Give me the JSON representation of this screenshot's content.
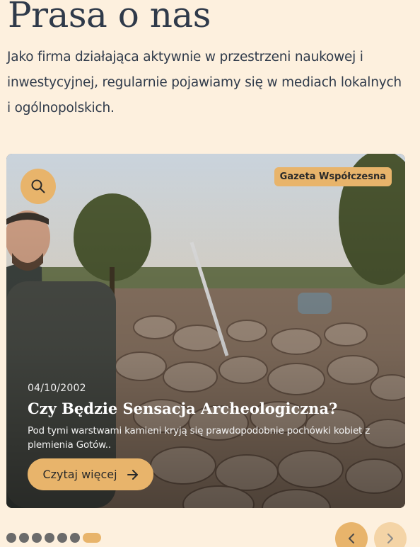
{
  "section": {
    "title": "Prasa o nas",
    "intro": "Jako firma działająca aktywnie w przestrzeni naukowej i inwestycyjnej, regularnie pojawiamy się w mediach lokalnych i ogólnopolskich."
  },
  "article": {
    "source": "Gazeta Współczesna",
    "date": "04/10/2002",
    "headline": "Czy Będzie Sensacja Archeologiczna?",
    "excerpt": "Pod tymi warstwami kamieni kryją się prawdopodobnie pochówki kobiet z plemienia Gotów..",
    "read_more": "Czytaj więcej",
    "photo_subject": "man-at-stone-excavation-site"
  },
  "carousel": {
    "slide_count": 7,
    "active_index": 6
  },
  "icons": {
    "search": "search-icon",
    "arrow_right": "arrow-right-icon",
    "chevron_left": "chevron-left-icon",
    "chevron_right": "chevron-right-icon"
  },
  "colors": {
    "background": "#fdf0de",
    "accent": "#e8b46b",
    "accent_light": "#f4d4a6",
    "text": "#2f3a4a",
    "dot_inactive": "#6b6b6b"
  }
}
